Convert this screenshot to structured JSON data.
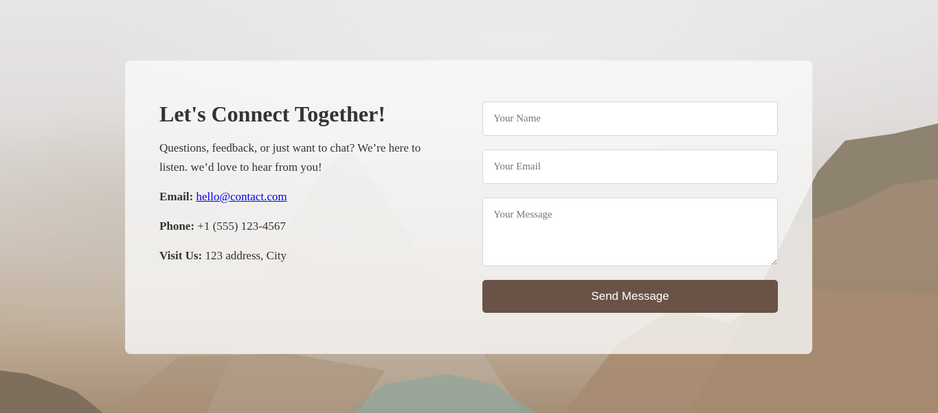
{
  "contact": {
    "title": "Let's Connect Together!",
    "intro": "Questions, feedback, or just want to chat? We’re here to listen. we’d love to hear from you!",
    "email_label": "Email:",
    "email_value": "hello@contact.com",
    "phone_label": "Phone:",
    "phone_value": "+1 (555) 123-4567",
    "visit_label": "Visit Us:",
    "visit_value": "123 address, City"
  },
  "form": {
    "name_placeholder": "Your Name",
    "email_placeholder": "Your Email",
    "message_placeholder": "Your Message",
    "submit_label": "Send Message"
  },
  "colors": {
    "button": "#6a5246",
    "text": "#333333",
    "link": "#0000ee"
  }
}
